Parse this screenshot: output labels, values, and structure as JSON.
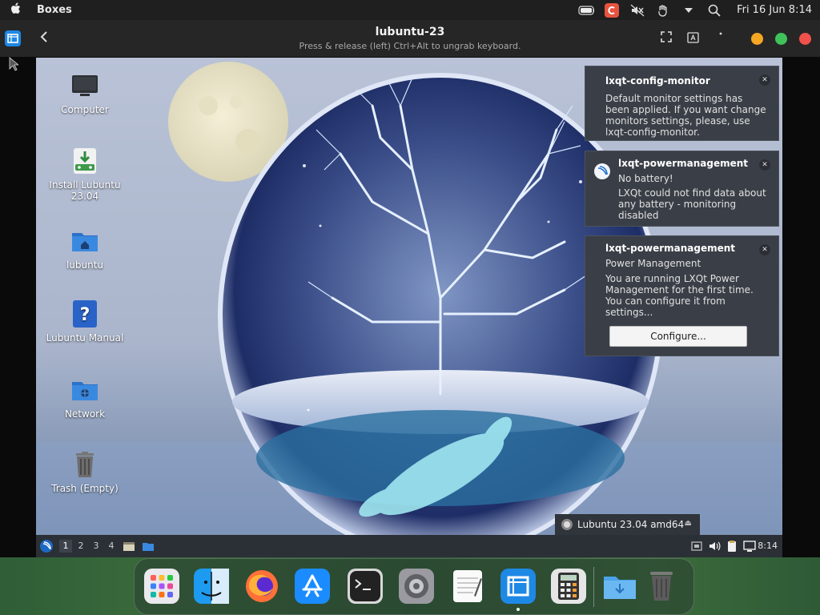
{
  "menubar": {
    "app_name": "Boxes",
    "clock": "Fri 16 Jun 8:14",
    "icons": [
      "apple-icon",
      "battery-icon",
      "c-app-icon",
      "mute-icon",
      "hand-icon",
      "chevron-down-icon",
      "search-icon"
    ]
  },
  "headerbar": {
    "title": "lubuntu-23",
    "subtitle": "Press & release (left) Ctrl+Alt to ungrab keyboard.",
    "buttons": [
      "back-icon",
      "fullscreen-icon",
      "keyboard-icon",
      "menu-icon"
    ],
    "traffic_colors": {
      "minimize": "#f5a623",
      "zoom": "#3fc25a",
      "close": "#f0514a"
    }
  },
  "desktop": {
    "icons": [
      {
        "label": "Computer",
        "icon": "computer-icon"
      },
      {
        "label": "Install Lubuntu 23.04",
        "icon": "install-icon"
      },
      {
        "label": "lubuntu",
        "icon": "home-folder-icon"
      },
      {
        "label": "Lubuntu Manual",
        "icon": "help-icon"
      },
      {
        "label": "Network",
        "icon": "network-folder-icon"
      },
      {
        "label": "Trash (Empty)",
        "icon": "trash-icon"
      }
    ]
  },
  "notifications": [
    {
      "app": "lxqt-config-monitor",
      "summary": "",
      "body": "Default monitor settings has been applied. If you want change monitors settings, please, use lxqt-config-monitor."
    },
    {
      "app": "lxqt-powermanagement",
      "summary": "No battery!",
      "body": "LXQt could not find data about any battery - monitoring disabled"
    },
    {
      "app": "lxqt-powermanagement",
      "summary": "Power Management",
      "body": "You are running LXQt Power Management for the first time. You can configure it from settings...",
      "action": "Configure..."
    }
  ],
  "media_popup": {
    "label": "Lubuntu 23.04 amd64"
  },
  "panel": {
    "workspaces": [
      "1",
      "2",
      "3",
      "4"
    ],
    "active_workspace": "1",
    "clock": "8:14"
  },
  "dock": {
    "apps": [
      "launchpad-icon",
      "finder-icon",
      "firefox-icon",
      "app-store-icon",
      "terminal-icon",
      "system-preferences-icon",
      "textedit-icon",
      "boxes-icon",
      "calculator-icon",
      "downloads-folder-icon",
      "trash-icon"
    ],
    "running": "boxes-icon"
  },
  "colors": {
    "menubar_bg": "#1f1f1f",
    "headerbar_bg": "#262626",
    "panel_bg": "#2b3036",
    "notification_bg": "#3a3f47",
    "accent_blue": "#1e88e5"
  }
}
